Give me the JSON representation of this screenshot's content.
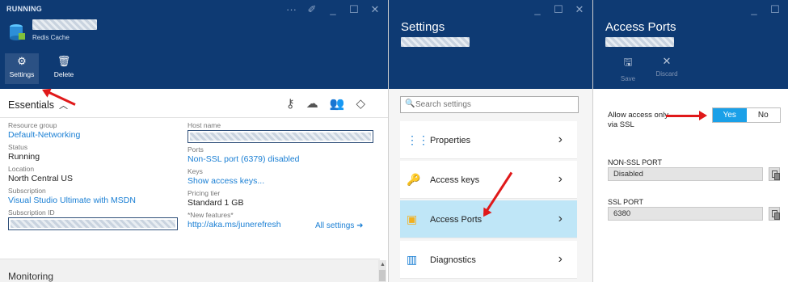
{
  "blade1": {
    "status": "RUNNING",
    "subtitle": "Redis Cache",
    "commands": {
      "settings": "Settings",
      "delete": "Delete"
    },
    "essentials_label": "Essentials",
    "left_fields": [
      {
        "key": "Resource group",
        "value": "Default-Networking",
        "link": true
      },
      {
        "key": "Status",
        "value": "Running",
        "link": false
      },
      {
        "key": "Location",
        "value": "North Central US",
        "link": false
      },
      {
        "key": "Subscription",
        "value": "Visual Studio Ultimate with MSDN",
        "link": true
      },
      {
        "key": "Subscription ID",
        "value": "",
        "link": false
      }
    ],
    "right_fields": [
      {
        "key": "Host name",
        "value": "",
        "link": false
      },
      {
        "key": "Ports",
        "value": "Non-SSL port (6379) disabled",
        "link": true
      },
      {
        "key": "Keys",
        "value": "Show access keys...",
        "link": true
      },
      {
        "key": "Pricing tier",
        "value": "Standard 1 GB",
        "link": false
      },
      {
        "key": "*New features*",
        "value": "http://aka.ms/junerefresh",
        "link": true
      }
    ],
    "all_settings": "All settings ➜",
    "monitoring": "Monitoring"
  },
  "blade2": {
    "title": "Settings",
    "search_placeholder": "Search settings",
    "items": [
      {
        "label": "Properties",
        "icon": "properties-icon"
      },
      {
        "label": "Access keys",
        "icon": "key-icon"
      },
      {
        "label": "Access Ports",
        "icon": "lock-icon",
        "selected": true
      },
      {
        "label": "Diagnostics",
        "icon": "diagnostics-icon"
      }
    ]
  },
  "blade3": {
    "title": "Access Ports",
    "commands": {
      "save": "Save",
      "discard": "Discard"
    },
    "ssl_label": "Allow access only via SSL",
    "toggle": {
      "yes": "Yes",
      "no": "No",
      "selected": "Yes"
    },
    "non_ssl_label": "NON-SSL PORT",
    "non_ssl_value": "Disabled",
    "ssl_port_label": "SSL PORT",
    "ssl_port_value": "6380"
  },
  "colors": {
    "header": "#0e3a73",
    "link": "#1a7fd4",
    "selected": "#bfe6f7",
    "toggle_on": "#1aa0e8",
    "arrow": "#e0191a"
  }
}
